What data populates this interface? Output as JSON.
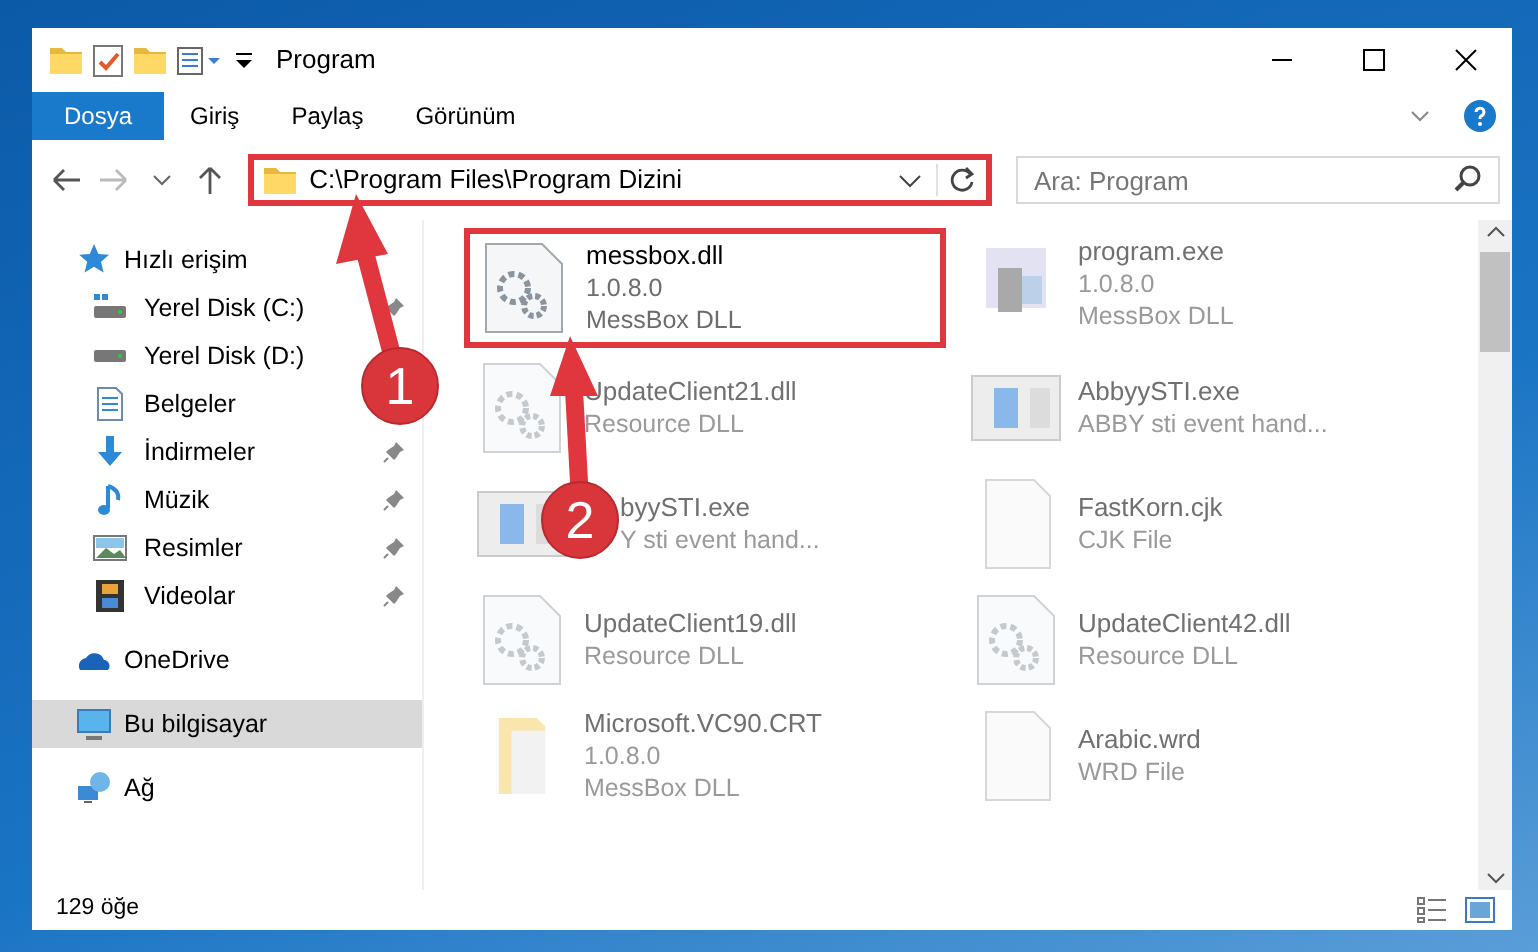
{
  "window": {
    "title": "Program"
  },
  "ribbon_tabs": [
    {
      "label": "Dosya",
      "selected": true
    },
    {
      "label": "Giriş",
      "selected": false
    },
    {
      "label": "Paylaş",
      "selected": false
    },
    {
      "label": "Görünüm",
      "selected": false
    }
  ],
  "address": {
    "path": "C:\\Program Files\\Program Dizini",
    "highlighted": true
  },
  "search": {
    "placeholder": "Ara: Program"
  },
  "sidebar": {
    "items": [
      {
        "label": "Hızlı erişim",
        "selected": false,
        "children": [
          {
            "label": "Yerel Disk (C:)",
            "pinned": true
          },
          {
            "label": "Yerel Disk (D:)",
            "pinned": false
          },
          {
            "label": "Belgeler",
            "pinned": false
          },
          {
            "label": "İndirmeler",
            "pinned": true
          },
          {
            "label": "Müzik",
            "pinned": true
          },
          {
            "label": "Resimler",
            "pinned": true
          },
          {
            "label": "Videolar",
            "pinned": true
          }
        ]
      },
      {
        "label": "OneDrive",
        "selected": false
      },
      {
        "label": "Bu bilgisayar",
        "selected": true
      },
      {
        "label": "Ağ",
        "selected": false
      }
    ]
  },
  "files": [
    {
      "name": "messbox.dll",
      "lines": [
        "1.0.8.0",
        "MessBox DLL"
      ],
      "highlighted": true,
      "blurred": false
    },
    {
      "name": "program.exe",
      "lines": [
        "1.0.8.0",
        "MessBox DLL"
      ],
      "highlighted": false,
      "blurred": true
    },
    {
      "name": "UpdateClient21.dll",
      "lines": [
        "Resource DLL"
      ],
      "highlighted": false,
      "blurred": true
    },
    {
      "name": "AbbyySTI.exe",
      "lines": [
        "ABBY sti event hand..."
      ],
      "highlighted": false,
      "blurred": true
    },
    {
      "name": "byySTI.exe",
      "lines": [
        "Y sti event hand..."
      ],
      "highlighted": false,
      "blurred": true
    },
    {
      "name": "FastKorn.cjk",
      "lines": [
        "CJK File"
      ],
      "highlighted": false,
      "blurred": true
    },
    {
      "name": "UpdateClient19.dll",
      "lines": [
        "Resource DLL"
      ],
      "highlighted": false,
      "blurred": true
    },
    {
      "name": "UpdateClient42.dll",
      "lines": [
        "Resource DLL"
      ],
      "highlighted": false,
      "blurred": true
    },
    {
      "name": "Microsoft.VC90.CRT",
      "lines": [
        "1.0.8.0",
        "MessBox DLL"
      ],
      "highlighted": false,
      "blurred": true
    },
    {
      "name": "Arabic.wrd",
      "lines": [
        "WRD File"
      ],
      "highlighted": false,
      "blurred": true
    }
  ],
  "status_bar": {
    "count": "129 öğe"
  },
  "annotations": [
    {
      "label": "1"
    },
    {
      "label": "2"
    }
  ]
}
